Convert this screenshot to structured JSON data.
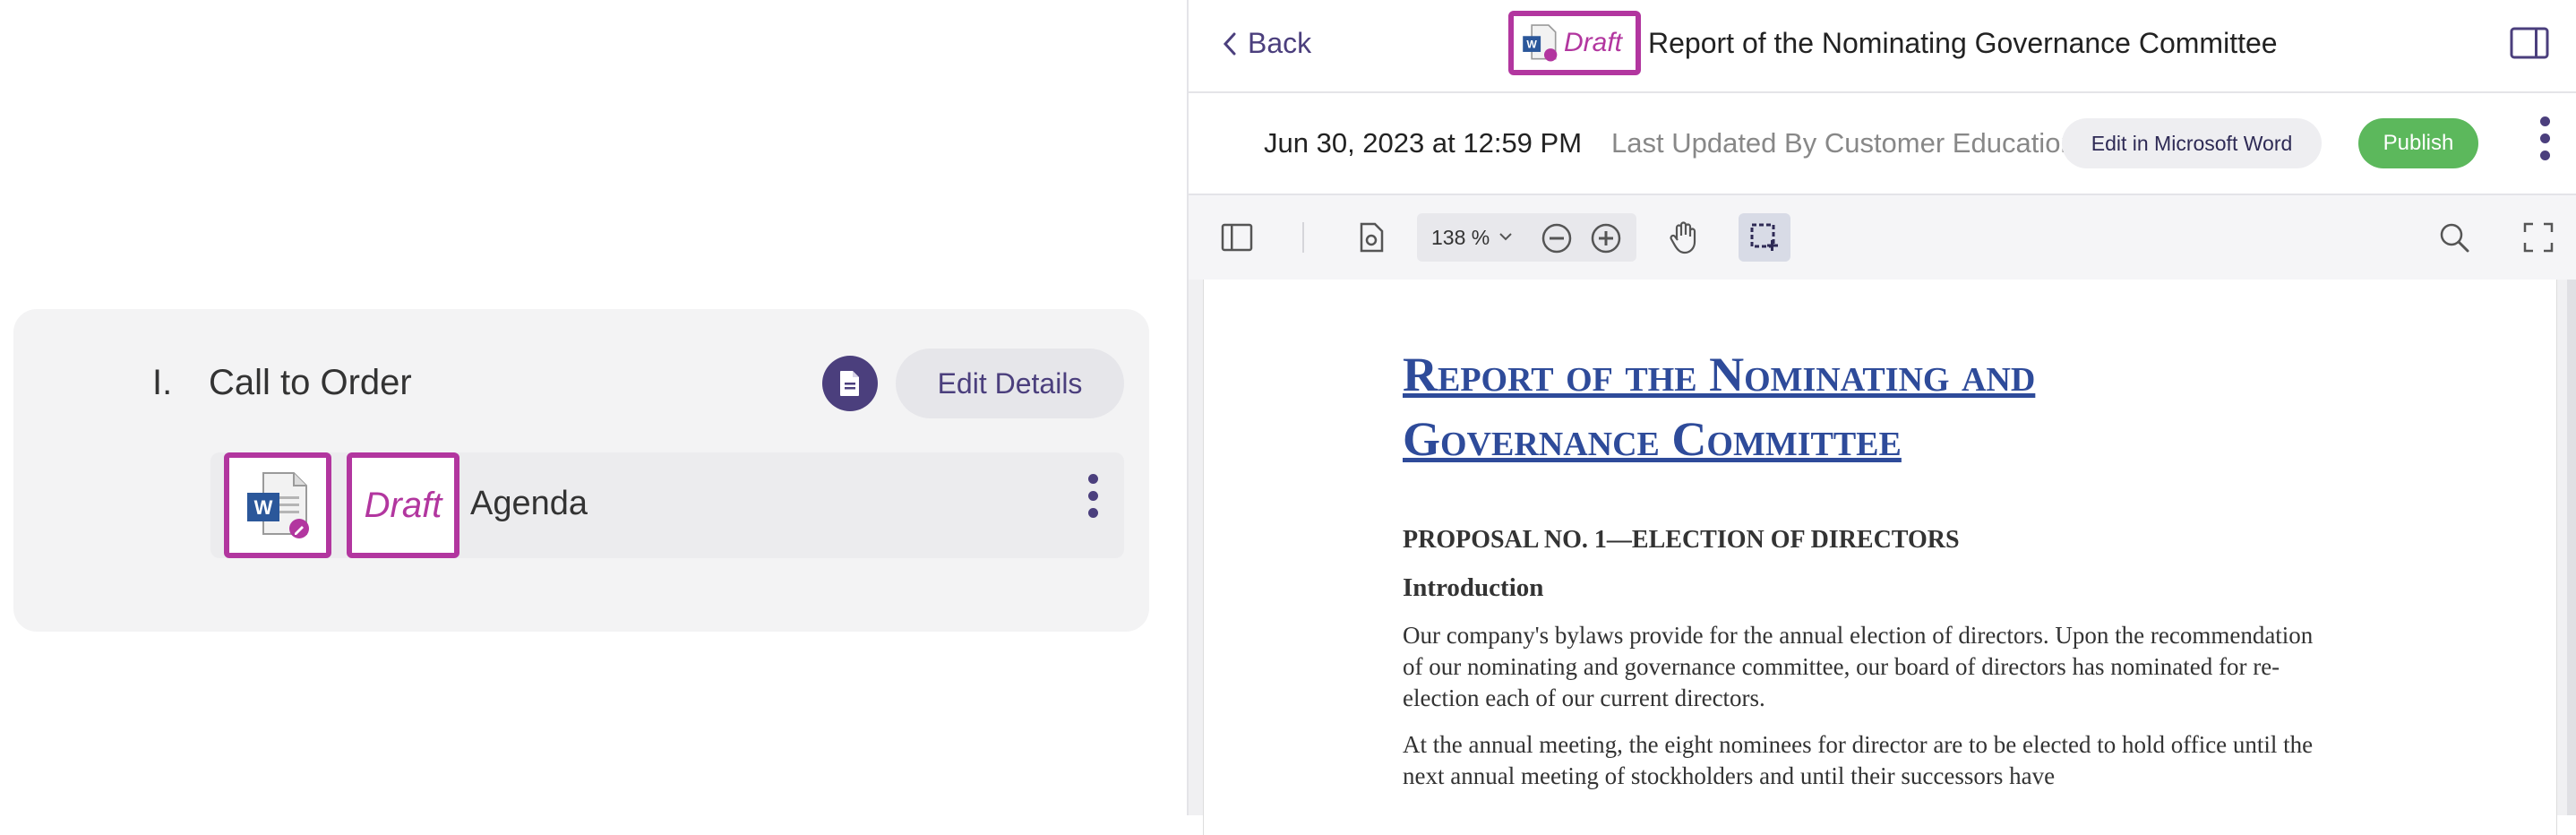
{
  "colors": {
    "accent": "#4b3f7d",
    "highlight": "#b2369f",
    "publish": "#5cb85c",
    "doc_heading": "#2e4b9a"
  },
  "agenda": {
    "item_number": "I.",
    "item_title": "Call to Order",
    "doc_icon": "document-icon",
    "edit_details_label": "Edit Details",
    "attachment": {
      "icon": "word-doc-icon",
      "status": "Draft",
      "name": "Agenda",
      "menu_icon": "kebab-menu-icon"
    }
  },
  "viewer": {
    "back_label": "Back",
    "status": "Draft",
    "title": "Report of the Nominating Governance Committee",
    "date": "Jun 30, 2023 at 12:59 PM",
    "last_updated": "Last Updated By Customer Education",
    "edit_word_label": "Edit in Microsoft Word",
    "publish_label": "Publish",
    "toolbar": {
      "zoom": "138 %",
      "icons": [
        "sidebar-toggle-icon",
        "page-settings-icon",
        "zoom-out-icon",
        "zoom-in-icon",
        "pan-hand-icon",
        "marquee-select-icon",
        "search-icon",
        "fullscreen-icon"
      ]
    },
    "document": {
      "heading_line1": "Report of the Nominating and",
      "heading_line2": "Governance Committee",
      "section": "PROPOSAL NO. 1—ELECTION OF DIRECTORS",
      "subsection": "Introduction",
      "para1": "Our company's bylaws provide for the annual election of directors. Upon the recommendation of our nominating and governance committee, our board of directors has nominated for re-election each of our current directors.",
      "para2": "At the annual meeting, the eight nominees for director are to be elected to hold office until the next annual meeting of stockholders and until their successors have"
    }
  }
}
